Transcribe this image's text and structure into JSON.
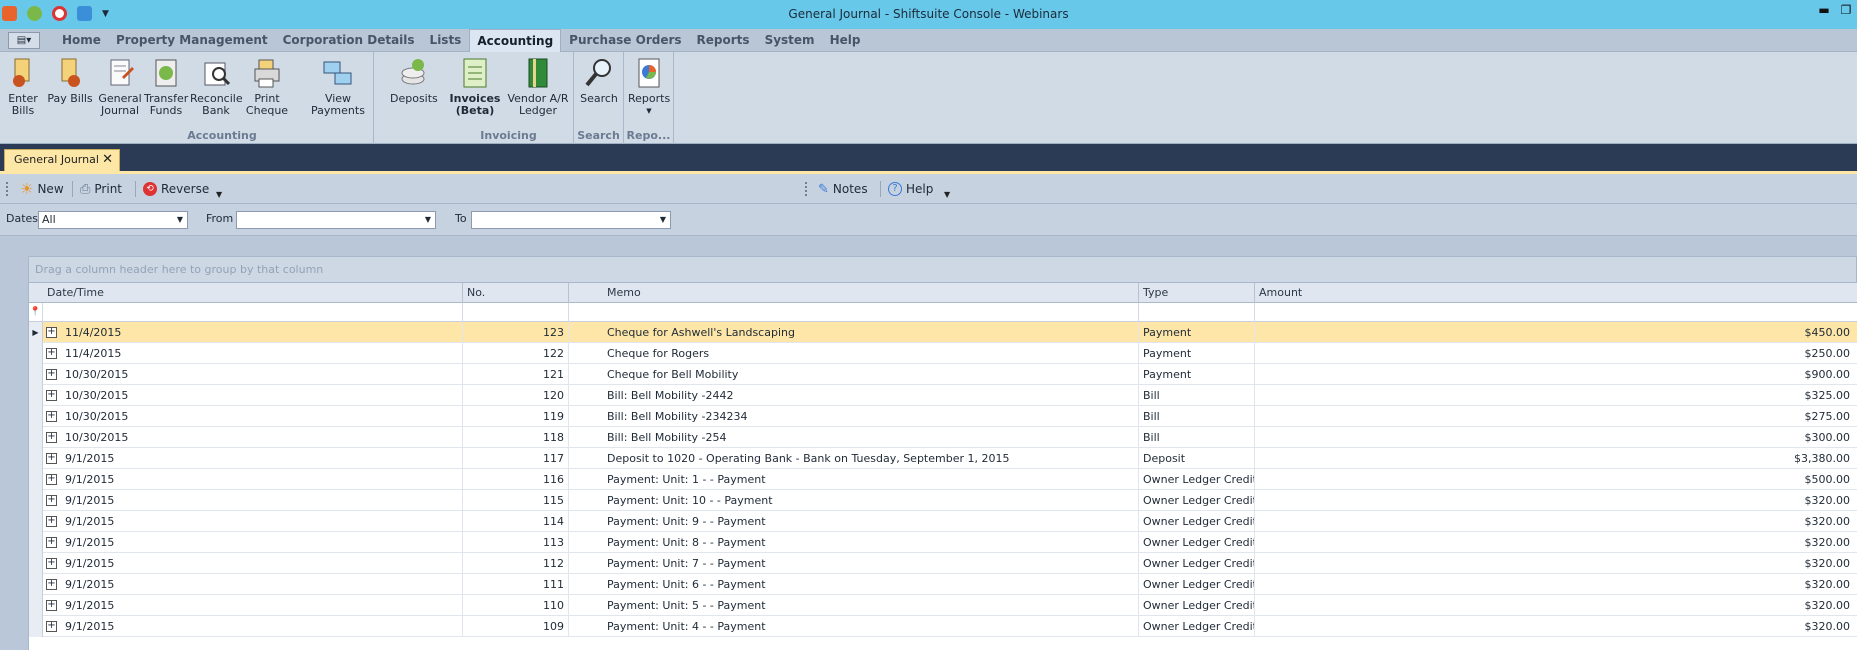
{
  "titlebar": {
    "title": "General Journal - Shiftsuite Console - Webinars",
    "min": "▬",
    "max": "❐"
  },
  "menu": {
    "app_button": "▤▾",
    "tabs": [
      {
        "label": "Home"
      },
      {
        "label": "Property Management"
      },
      {
        "label": "Corporation Details"
      },
      {
        "label": "Lists"
      },
      {
        "label": "Accounting"
      },
      {
        "label": "Purchase Orders"
      },
      {
        "label": "Reports"
      },
      {
        "label": "System"
      },
      {
        "label": "Help"
      }
    ],
    "active_tab": "Accounting"
  },
  "ribbon": {
    "groups": [
      {
        "name": "Accounting",
        "buttons": [
          "Enter\nBills",
          "Pay Bills",
          "General\nJournal",
          "Transfer\nFunds",
          "Reconcile\nBank",
          "Print\nCheque",
          "View Payments",
          "Deposits"
        ]
      },
      {
        "name": "Invoicing",
        "buttons": [
          "Invoices\n(Beta)",
          "Vendor A/R\nLedger"
        ]
      },
      {
        "name": "Search",
        "buttons": [
          "Search"
        ]
      },
      {
        "name": "Repo...",
        "buttons": [
          "Reports"
        ]
      }
    ]
  },
  "doc_tab": {
    "label": "General Journal",
    "close": "✕"
  },
  "toolbar": {
    "new": "New",
    "print": "Print",
    "reverse": "Reverse",
    "notes": "Notes",
    "help": "Help"
  },
  "filters": {
    "dates_label": "Dates",
    "dates_value": "All",
    "from_label": "From",
    "from_value": "",
    "to_label": "To",
    "to_value": ""
  },
  "grid": {
    "group_hint": "Drag a column header here to group by that column",
    "columns": [
      "Date/Time",
      "No.",
      "Memo",
      "Type",
      "Amount"
    ],
    "rows": [
      {
        "date": "11/4/2015",
        "no": "123",
        "memo": "Cheque for Ashwell's Landscaping",
        "type": "Payment",
        "amount": "$450.00"
      },
      {
        "date": "11/4/2015",
        "no": "122",
        "memo": "Cheque for Rogers",
        "type": "Payment",
        "amount": "$250.00"
      },
      {
        "date": "10/30/2015",
        "no": "121",
        "memo": "Cheque for Bell Mobility",
        "type": "Payment",
        "amount": "$900.00"
      },
      {
        "date": "10/30/2015",
        "no": "120",
        "memo": "Bill: Bell Mobility -2442",
        "type": "Bill",
        "amount": "$325.00"
      },
      {
        "date": "10/30/2015",
        "no": "119",
        "memo": "Bill: Bell Mobility -234234",
        "type": "Bill",
        "amount": "$275.00"
      },
      {
        "date": "10/30/2015",
        "no": "118",
        "memo": "Bill: Bell Mobility -254",
        "type": "Bill",
        "amount": "$300.00"
      },
      {
        "date": "9/1/2015",
        "no": "117",
        "memo": "Deposit to 1020 - Operating Bank - Bank on Tuesday, September 1, 2015",
        "type": "Deposit",
        "amount": "$3,380.00"
      },
      {
        "date": "9/1/2015",
        "no": "116",
        "memo": "Payment: Unit: 1 -  - Payment",
        "type": "Owner Ledger Credit",
        "amount": "$500.00"
      },
      {
        "date": "9/1/2015",
        "no": "115",
        "memo": "Payment: Unit: 10 -  - Payment",
        "type": "Owner Ledger Credit",
        "amount": "$320.00"
      },
      {
        "date": "9/1/2015",
        "no": "114",
        "memo": "Payment: Unit: 9 -  - Payment",
        "type": "Owner Ledger Credit",
        "amount": "$320.00"
      },
      {
        "date": "9/1/2015",
        "no": "113",
        "memo": "Payment: Unit: 8 -  - Payment",
        "type": "Owner Ledger Credit",
        "amount": "$320.00"
      },
      {
        "date": "9/1/2015",
        "no": "112",
        "memo": "Payment: Unit: 7 -  - Payment",
        "type": "Owner Ledger Credit",
        "amount": "$320.00"
      },
      {
        "date": "9/1/2015",
        "no": "111",
        "memo": "Payment: Unit: 6 -  - Payment",
        "type": "Owner Ledger Credit",
        "amount": "$320.00"
      },
      {
        "date": "9/1/2015",
        "no": "110",
        "memo": "Payment: Unit: 5 -  - Payment",
        "type": "Owner Ledger Credit",
        "amount": "$320.00"
      },
      {
        "date": "9/1/2015",
        "no": "109",
        "memo": "Payment: Unit: 4 -  - Payment",
        "type": "Owner Ledger Credit",
        "amount": "$320.00"
      }
    ],
    "selected_row": 0
  }
}
